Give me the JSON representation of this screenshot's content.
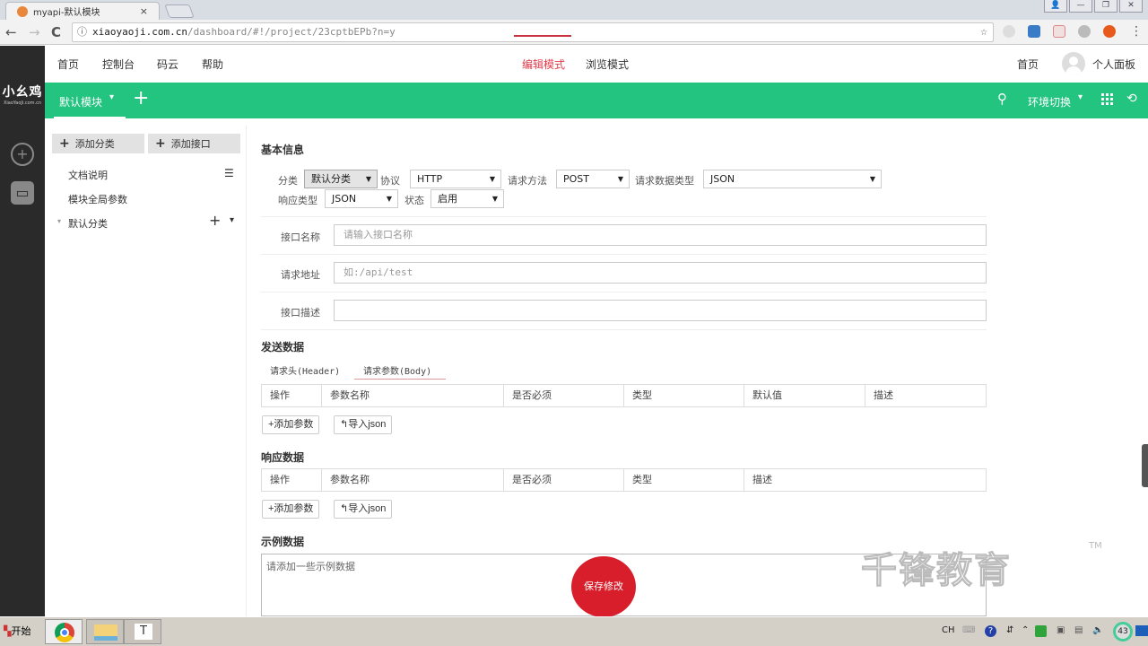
{
  "browser": {
    "tab_title": "myapi-默认模块",
    "tab_close": "×",
    "url_host": "xiaoyaoji.com.cn",
    "url_path": "/dashboard/#!/project/23cptbEPb?n=y",
    "back": "←",
    "forward": "→",
    "reload": "C",
    "info_icon": "ⓘ",
    "star_icon": "☆",
    "menu_icon": "⋮",
    "win_buttons": [
      "👤",
      "—",
      "❐",
      "✕"
    ]
  },
  "logo": {
    "text": "小幺鸡",
    "sub": "XiaoYaoJi.com.cn"
  },
  "topnav": {
    "links": [
      "首页",
      "控制台",
      "码云",
      "帮助"
    ],
    "modes": [
      {
        "label": "编辑模式",
        "active": true
      },
      {
        "label": "浏览模式",
        "active": false
      }
    ],
    "right_home": "首页",
    "user_panel": "个人面板"
  },
  "greenbar": {
    "module": "默认模块",
    "caret": "▾",
    "add": "+",
    "search_icon": "⚲",
    "env_switch": "环境切换",
    "history_icon": "⟲",
    "accent": "#23c380"
  },
  "left_panel": {
    "add_category": "添加分类",
    "add_interface": "添加接口",
    "items": [
      "文档说明",
      "模块全局参数"
    ],
    "category": "默认分类",
    "list_icon": "☰",
    "plus": "+",
    "caret": "▾"
  },
  "form": {
    "basic_info": "基本信息",
    "category_label": "分类",
    "category_value": "默认分类",
    "protocol_label": "协议",
    "protocol_value": "HTTP",
    "method_label": "请求方法",
    "method_value": "POST",
    "req_type_label": "请求数据类型",
    "req_type_value": "JSON",
    "resp_type_label": "响应类型",
    "resp_type_value": "JSON",
    "status_label": "状态",
    "status_value": "启用",
    "name_label": "接口名称",
    "name_placeholder": "请输入接口名称",
    "url_label": "请求地址",
    "url_placeholder": "如:/api/test",
    "desc_label": "接口描述",
    "desc_value": ""
  },
  "send_data": {
    "title": "发送数据",
    "tabs": [
      {
        "label": "请求头(Header)",
        "active": false
      },
      {
        "label": "请求参数(Body)",
        "active": true
      }
    ],
    "columns": [
      "操作",
      "参数名称",
      "是否必须",
      "类型",
      "默认值",
      "描述"
    ],
    "add_param": "+添加参数",
    "import_json": "↰导入json"
  },
  "response_data": {
    "title": "响应数据",
    "columns": [
      "操作",
      "参数名称",
      "是否必须",
      "类型",
      "描述"
    ],
    "add_param": "+添加参数",
    "import_json": "↰导入json"
  },
  "example": {
    "title": "示例数据",
    "placeholder": "请添加一些示例数据",
    "save": "保存修改"
  },
  "watermark": {
    "text": "千锋教育",
    "tm": "TM"
  },
  "taskbar": {
    "start": "开始",
    "apps": [
      "chrome",
      "explorer",
      "T"
    ],
    "lang": "CH",
    "clock_badge": "43"
  }
}
